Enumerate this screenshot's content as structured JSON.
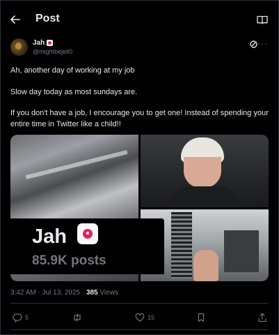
{
  "header": {
    "title": "Post"
  },
  "author": {
    "name": "Jah",
    "handle": "@mightbejell0"
  },
  "post": {
    "line1": "Ah, another day of working at my job",
    "line2": "Slow day today as most sundays are.",
    "line3": "If you don't have a job, I encourage you to get one! Instead of spending your entire time in Twitter like a child!!"
  },
  "overlay": {
    "name": "Jah",
    "posts": "85.9K posts"
  },
  "meta": {
    "timestamp": "3:42 AM · Jul 13, 2025 · ",
    "views_count": "385",
    "views_label": " Views"
  },
  "actions": {
    "replies": "5",
    "likes": "15"
  },
  "icons": [
    "back-arrow-icon",
    "reader-icon",
    "grok-icon",
    "more-icon",
    "reply-icon",
    "repost-icon",
    "like-icon",
    "bookmark-icon",
    "share-icon"
  ],
  "colors": {
    "background": "#000000",
    "text": "#e7e9ea",
    "muted": "#71767b",
    "divider": "#2f3336",
    "badge_red": "#e0245e"
  }
}
